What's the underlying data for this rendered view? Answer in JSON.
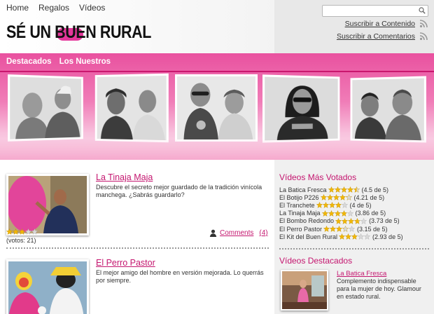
{
  "top_nav": [
    "Home",
    "Regalos",
    "Vídeos"
  ],
  "logo": {
    "text": "SÉ UN BUEN RURAL"
  },
  "search": {
    "placeholder": ""
  },
  "feeds": {
    "content": "Suscribir a Contenido",
    "comments": "Suscribir a Comentarios"
  },
  "section_nav": [
    "Destacados",
    "Los Nuestros"
  ],
  "colors": {
    "accent": "#c4166f",
    "banner_pink": "#e9519f",
    "star_gold": "#f2b705",
    "star_empty": "#d9d9d9"
  },
  "posts": [
    {
      "title": "La Tinaja Maja",
      "description": "Descubre el secreto mejor guardado de la tradición vinícola manchega. ¿Sabrás guardarlo?",
      "rating": 3,
      "votes_label": "(votos: 21)",
      "comments_label": "Comments",
      "comments_count": "(4)"
    },
    {
      "title": "El Perro Pastor",
      "description": "El mejor amigo del hombre en versión mejorada. Lo querrás por siempre."
    }
  ],
  "sidebar": {
    "top_rated_title": "Vídeos Más Votados",
    "top_rated": [
      {
        "name": "La Batica Fresca",
        "rating": 4.5,
        "score": "(4.5 de 5)"
      },
      {
        "name": "El Botijo P226",
        "rating": 4.21,
        "score": "(4.21 de 5)"
      },
      {
        "name": "El Tranchete",
        "rating": 4,
        "score": "(4 de 5)"
      },
      {
        "name": "La Tinaja Maja",
        "rating": 3.86,
        "score": "(3.86 de 5)"
      },
      {
        "name": "El Bombo Redondo",
        "rating": 3.73,
        "score": "(3.73 de 5)"
      },
      {
        "name": "El Perro Pastor",
        "rating": 3.15,
        "score": "(3.15 de 5)"
      },
      {
        "name": "El Kit del Buen Rural",
        "rating": 2.93,
        "score": "(2.93 de 5)"
      }
    ],
    "featured_title": "Vídeos Destacados",
    "featured": {
      "name": "La Batica Fresca",
      "description": "Complemento indispensable para la mujer de hoy. Glamour en estado rural."
    }
  }
}
